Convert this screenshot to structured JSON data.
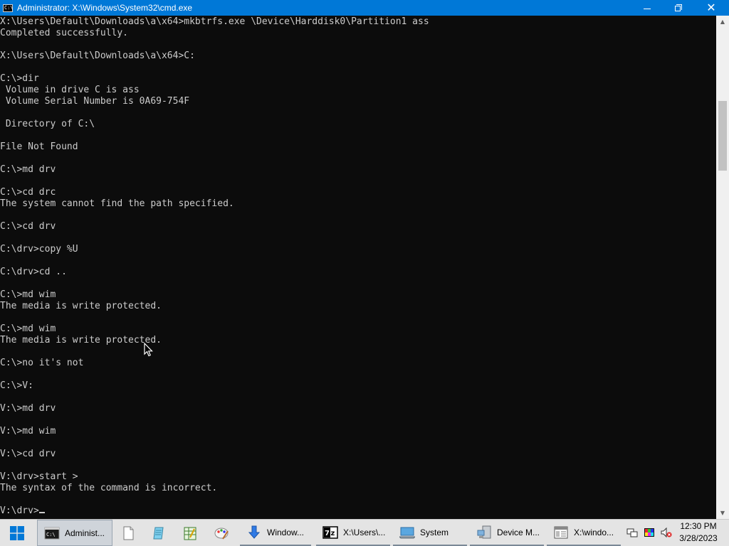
{
  "window": {
    "title": "Administrator: X:\\Windows\\System32\\cmd.exe",
    "icon_text": "C:\\",
    "minimize_icon": "minimize-icon",
    "maximize_icon": "restore-icon",
    "close_glyph": "✕"
  },
  "console": {
    "lines": [
      "X:\\Users\\Default\\Downloads\\a\\x64>mkbtrfs.exe \\Device\\Harddisk0\\Partition1 ass",
      "Completed successfully.",
      "",
      "X:\\Users\\Default\\Downloads\\a\\x64>C:",
      "",
      "C:\\>dir",
      " Volume in drive C is ass",
      " Volume Serial Number is 0A69-754F",
      "",
      " Directory of C:\\",
      "",
      "File Not Found",
      "",
      "C:\\>md drv",
      "",
      "C:\\>cd drc",
      "The system cannot find the path specified.",
      "",
      "C:\\>cd drv",
      "",
      "C:\\drv>copy %U",
      "",
      "C:\\drv>cd ..",
      "",
      "C:\\>md wim",
      "The media is write protected.",
      "",
      "C:\\>md wim",
      "The media is write protected.",
      "",
      "C:\\>no it's not",
      "",
      "C:\\>V:",
      "",
      "V:\\>md drv",
      "",
      "V:\\>md wim",
      "",
      "V:\\>cd drv",
      "",
      "V:\\drv>start >",
      "The syntax of the command is incorrect.",
      ""
    ],
    "prompt": "V:\\drv>"
  },
  "taskbar": {
    "start_icon": "windows-logo-icon",
    "items": [
      {
        "label": "Administ...",
        "icon": "cmd-icon"
      },
      {
        "label": "",
        "icon": "blank-document-icon"
      },
      {
        "label": "",
        "icon": "notepad-icon"
      },
      {
        "label": "",
        "icon": "spreadsheet-icon"
      },
      {
        "label": "",
        "icon": "paint-icon"
      },
      {
        "label": "Window...",
        "icon": "download-arrow-icon"
      },
      {
        "label": "X:\\Users\\...",
        "icon": "7zip-icon"
      },
      {
        "label": "System",
        "icon": "system-computer-icon"
      },
      {
        "label": "Device M...",
        "icon": "device-manager-icon"
      },
      {
        "label": "X:\\windo...",
        "icon": "explorer-window-icon"
      }
    ],
    "tray": {
      "icons": [
        "network-icon",
        "color-palette-icon",
        "volume-muted-icon"
      ],
      "time": "12:30 PM",
      "date": "3/28/2023"
    }
  }
}
